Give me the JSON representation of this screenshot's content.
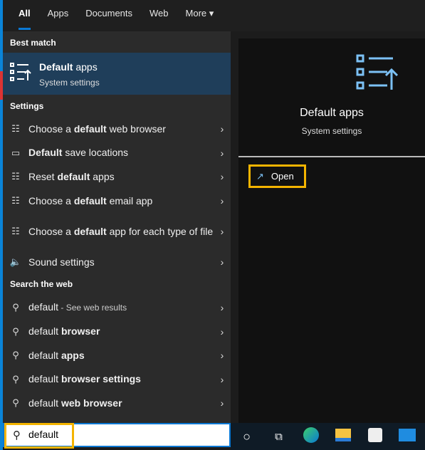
{
  "tabs": [
    {
      "label": "All",
      "active": true
    },
    {
      "label": "Apps"
    },
    {
      "label": "Documents"
    },
    {
      "label": "Web"
    },
    {
      "label": "More ▾"
    }
  ],
  "best_match": {
    "header": "Best match",
    "title_bold": "Default",
    "title_rest": " apps",
    "subtitle": "System settings",
    "icon": "default-apps-icon"
  },
  "settings": {
    "header": "Settings",
    "items": [
      {
        "icon": "list-icon",
        "pre": "Choose a ",
        "bold": "default",
        "post": " web browser"
      },
      {
        "icon": "drive-icon",
        "pre": "",
        "bold": "Default",
        "post": " save locations"
      },
      {
        "icon": "list-icon",
        "pre": "Reset ",
        "bold": "default",
        "post": " apps"
      },
      {
        "icon": "list-icon",
        "pre": "Choose a ",
        "bold": "default",
        "post": " email app"
      },
      {
        "icon": "list-icon",
        "pre": "Choose a ",
        "bold": "default",
        "post": " app for each type of file"
      },
      {
        "icon": "speaker-icon",
        "pre": "Sound settings",
        "bold": "",
        "post": ""
      }
    ]
  },
  "web": {
    "header": "Search the web",
    "items": [
      {
        "pre": "default",
        "bold": "",
        "post": "",
        "see": " - See web results"
      },
      {
        "pre": "default ",
        "bold": "browser",
        "post": ""
      },
      {
        "pre": "default ",
        "bold": "apps",
        "post": ""
      },
      {
        "pre": "default ",
        "bold": "browser settings",
        "post": ""
      },
      {
        "pre": "default ",
        "bold": "web browser",
        "post": ""
      }
    ]
  },
  "preview": {
    "title": "Default apps",
    "subtitle": "System settings",
    "open_label": "Open"
  },
  "search": {
    "value": "default"
  },
  "taskbar": [
    "cortana-icon",
    "task-view-icon",
    "edge-icon",
    "file-explorer-icon",
    "store-icon",
    "mail-icon"
  ],
  "colors": {
    "accent": "#0a78d4",
    "highlight": "#f4b400",
    "selected": "#1f3e5a"
  }
}
